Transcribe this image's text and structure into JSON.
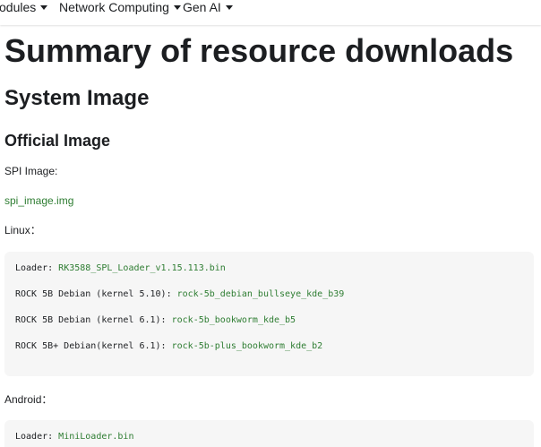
{
  "nav": {
    "items": [
      {
        "label": "odules"
      },
      {
        "label": "Network Computing"
      },
      {
        "label": "Gen AI"
      }
    ]
  },
  "page": {
    "title": "Summary of resource downloads",
    "section": "System Image",
    "subsection": "Official Image",
    "spi_label": "SPI Image:",
    "spi_link": "spi_image.img",
    "linux_label": "Linux：",
    "linux_lines": [
      {
        "label": "Loader:  ",
        "link": "RK3588_SPL_Loader_v1.15.113.bin"
      },
      {
        "label": "ROCK 5B Debian (kernel 5.10): ",
        "link": "rock-5b_debian_bullseye_kde_b39"
      },
      {
        "label": "ROCK 5B Debian (kernel 6.1): ",
        "link": "rock-5b_bookworm_kde_b5"
      },
      {
        "label": "ROCK 5B+ Debian(kernel 6.1): ",
        "link": "rock-5b-plus_bookworm_kde_b2"
      }
    ],
    "android_label": "Android：",
    "android_lines": [
      {
        "label": "Loader: ",
        "link": "MiniLoader.bin"
      }
    ]
  },
  "colors": {
    "link": "#2e7d32",
    "code_bg": "#f6f6f6",
    "text": "#1c1e21"
  }
}
